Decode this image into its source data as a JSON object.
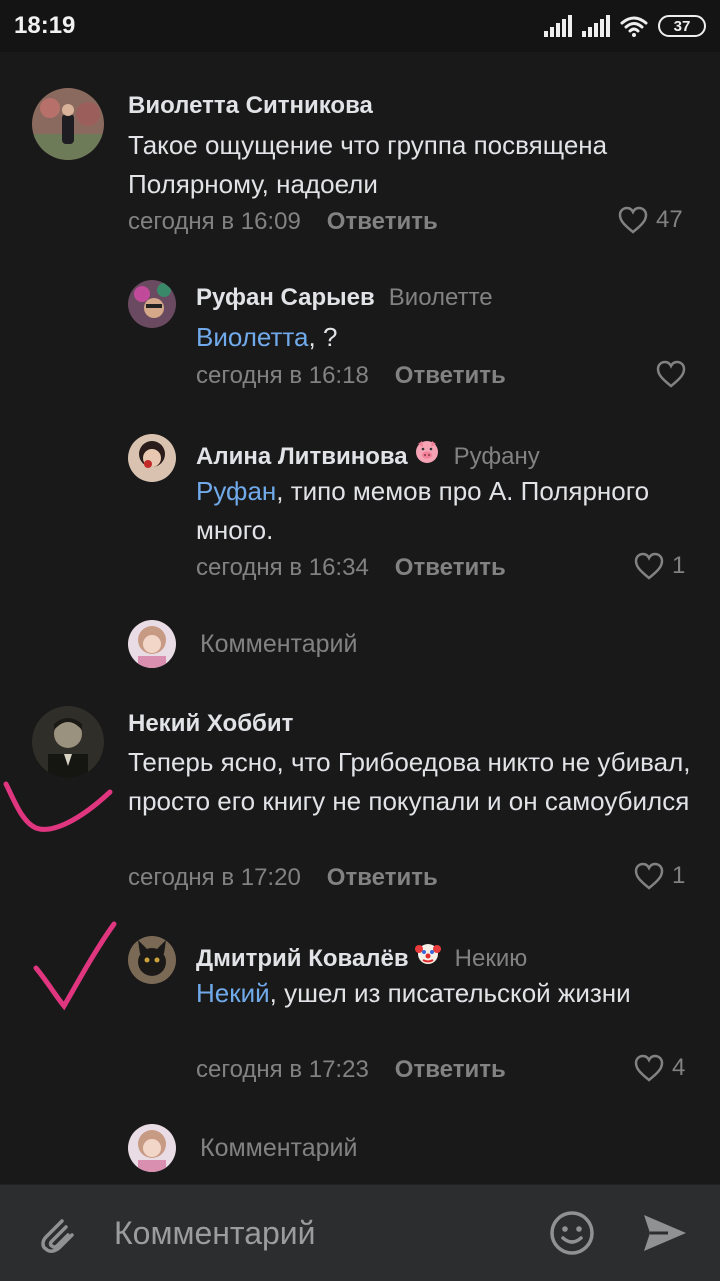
{
  "status_bar": {
    "time": "18:19",
    "battery": "37"
  },
  "comments": [
    {
      "author": "Виолетта Ситникова",
      "text": "Такое ощущение что группа посвящена Полярному, надоели",
      "time": "сегодня в 16:09",
      "reply_label": "Ответить",
      "likes": "47"
    },
    {
      "author": "Руфан Сарыев",
      "reply_to": "Виолетте",
      "mention": "Виолетта",
      "text": ", ?",
      "time": "сегодня в 16:18",
      "reply_label": "Ответить"
    },
    {
      "author": "Алина Литвинова",
      "emoji": "pig-face-icon",
      "reply_to": "Руфану",
      "mention": "Руфан",
      "text": ", типо мемов про А. Полярного много.",
      "time": "сегодня в 16:34",
      "reply_label": "Ответить",
      "likes": "1"
    },
    {
      "author": "Некий Хоббит",
      "text": "Теперь ясно, что Грибоедова никто не убивал, просто его книгу не покупали и он самоубился",
      "time": "сегодня в 17:20",
      "reply_label": "Ответить",
      "likes": "1"
    },
    {
      "author": "Дмитрий Ковалёв",
      "emoji": "clown-face-icon",
      "reply_to": "Некию",
      "mention": "Некий",
      "text": ", ушел из писательской жизни",
      "time": "сегодня в 17:23",
      "reply_label": "Ответить",
      "likes": "4"
    }
  ],
  "thread_reply_placeholder": "Комментарий",
  "composer": {
    "placeholder": "Комментарий"
  },
  "colors": {
    "background": "#19191a",
    "mention": "#71aaeb",
    "secondary": "#828282",
    "annotation": "#e0357f"
  }
}
